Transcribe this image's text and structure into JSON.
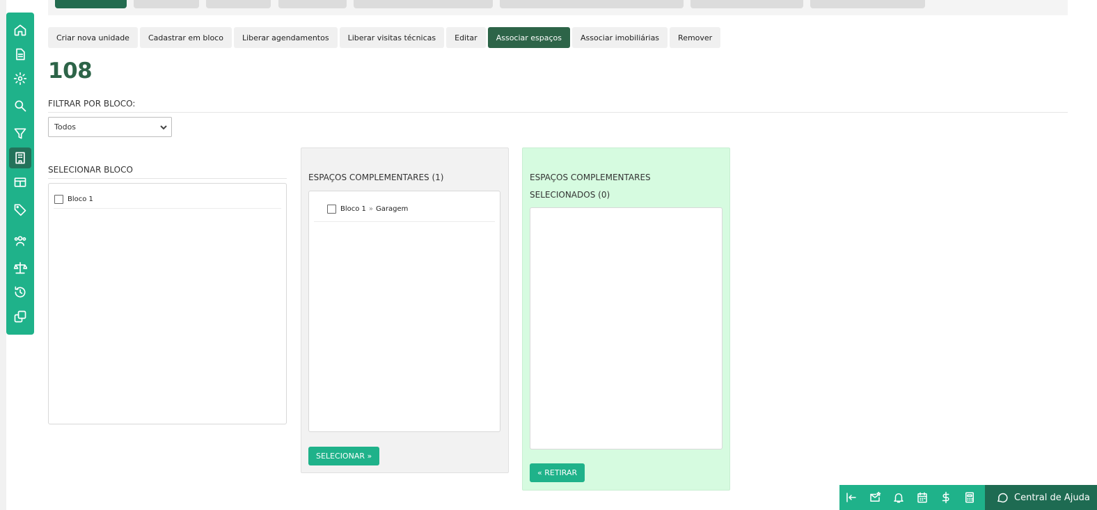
{
  "sidebar": {
    "items": [
      {
        "name": "home-icon"
      },
      {
        "name": "document-icon"
      },
      {
        "name": "gear-icon"
      },
      {
        "name": "search-icon"
      },
      {
        "name": "filter-icon"
      },
      {
        "name": "building-icon",
        "active": true
      },
      {
        "name": "table-icon"
      },
      {
        "name": "tag-icon"
      },
      {
        "name": "users-icon"
      },
      {
        "name": "scale-icon"
      },
      {
        "name": "history-icon"
      },
      {
        "name": "copy-icon"
      }
    ]
  },
  "actions": [
    {
      "label": "Criar nova unidade"
    },
    {
      "label": "Cadastrar em bloco"
    },
    {
      "label": "Liberar agendamentos"
    },
    {
      "label": "Liberar visitas técnicas"
    },
    {
      "label": "Editar"
    },
    {
      "label": "Associar espaços",
      "active": true
    },
    {
      "label": "Associar imobiliárias"
    },
    {
      "label": "Remover"
    }
  ],
  "unit_number": "108",
  "filter": {
    "label": "FILTRAR POR BLOCO:",
    "selected": "Todos"
  },
  "select_block": {
    "title": "SELECIONAR BLOCO",
    "items": [
      {
        "label": "Bloco 1"
      }
    ]
  },
  "spaces": {
    "title": "ESPAÇOS COMPLEMENTARES (1)",
    "items": [
      {
        "block": "Bloco 1",
        "sep": "»",
        "space": "Garagem"
      }
    ],
    "button": "SELECIONAR »"
  },
  "selected_spaces": {
    "title_line1": "ESPAÇOS COMPLEMENTARES",
    "title_line2": "SELECIONADOS (0)",
    "button": "« RETIRAR"
  },
  "bottom_bar": {
    "icons": [
      "collapse-icon",
      "mail-star-icon",
      "bell-icon",
      "calendar-icon",
      "dollar-icon",
      "calculator-icon"
    ],
    "help_label": "Central de Ajuda"
  },
  "colors": {
    "brand_green": "#1fb28a",
    "dark_green": "#2d6448",
    "selected_panel": "#d6fbe0"
  }
}
